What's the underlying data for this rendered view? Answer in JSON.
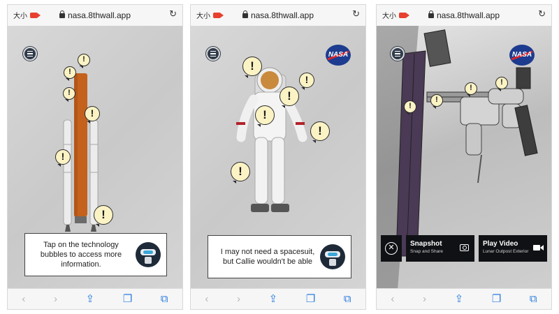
{
  "browser": {
    "recording_label": "大小",
    "url": "nasa.8thwall.app",
    "reload_icon": "reload-icon"
  },
  "toolbar_icons": [
    "back-icon",
    "forward-icon",
    "share-icon",
    "bookmarks-icon",
    "tabs-icon"
  ],
  "nasa_logo": "NASA",
  "bubble_glyph": "!",
  "screens": [
    {
      "dialog": {
        "line1": "Tap on the technology",
        "line2": "bubbles to access more",
        "line3": "information."
      }
    },
    {
      "dialog": {
        "line1": "I may not need a spacesuit,",
        "line2": "but Callie wouldn't be able"
      }
    },
    {
      "actions": {
        "close_glyph": "✕",
        "snapshot": {
          "title": "Snapshot",
          "subtitle": "Snap and Share"
        },
        "play_video": {
          "title": "Play Video",
          "subtitle": "Lunar Outpost Exterior"
        }
      }
    }
  ],
  "colors": {
    "nasa_blue": "#1d3c8f",
    "nasa_red": "#d8262e",
    "bubble_fill": "#fbf3c4",
    "ios_blue": "#2b7de0",
    "rocket_orange": "#c4611c"
  }
}
